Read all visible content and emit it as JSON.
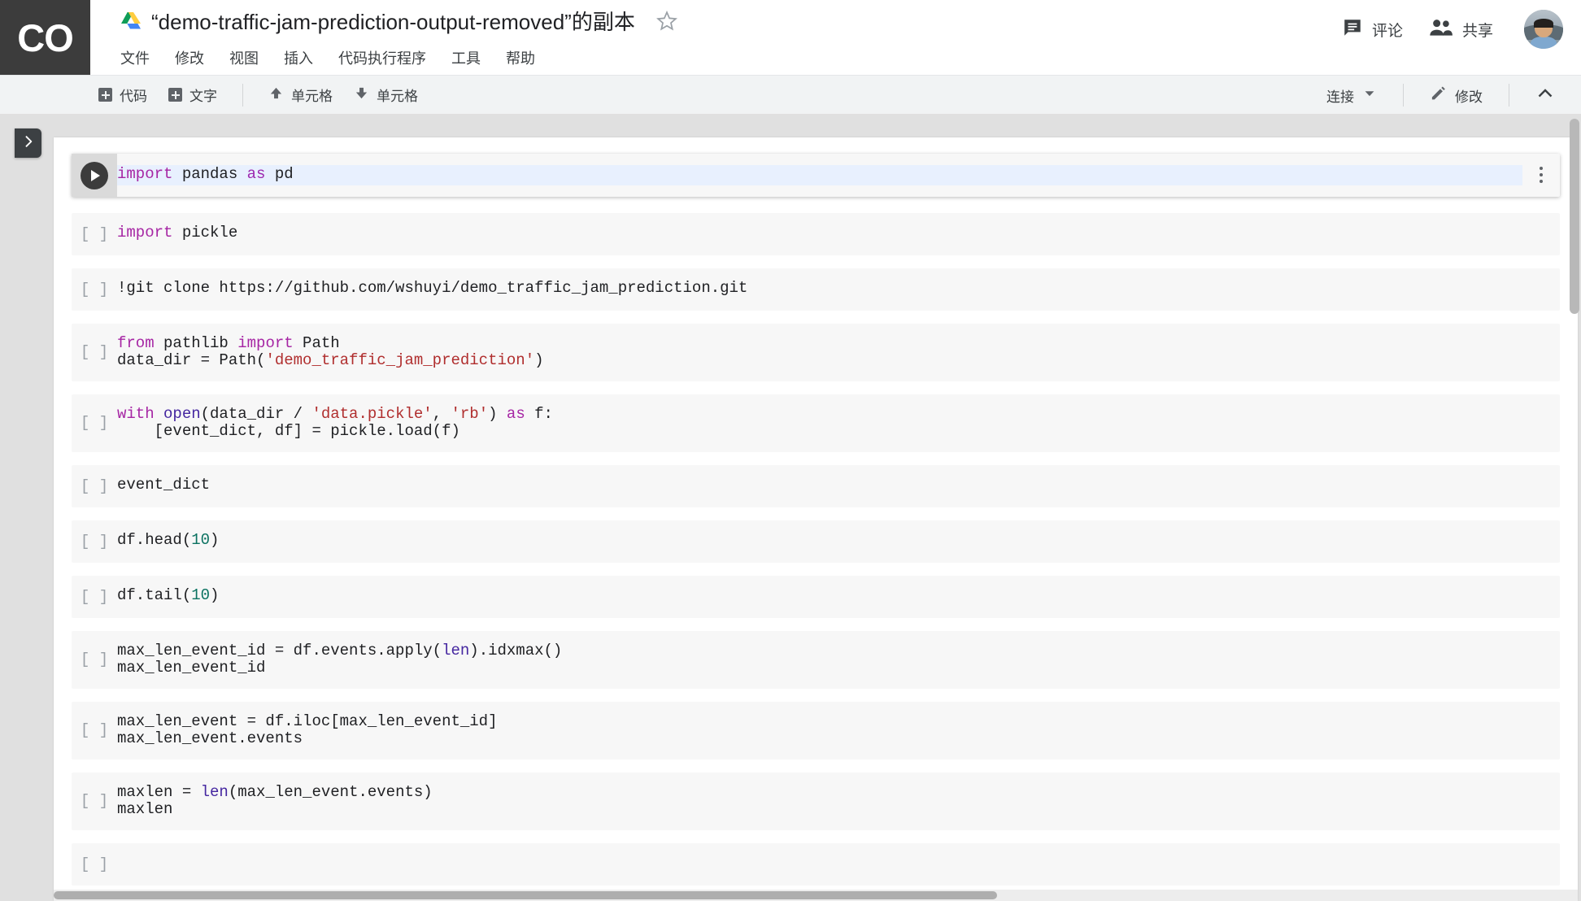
{
  "app": {
    "logo_text": "CO",
    "doc_title": "“demo-traffic-jam-prediction-output-removed”的副本",
    "drive_icon": "google-drive-icon",
    "star_icon": "star-outline-icon"
  },
  "menu": {
    "items": [
      {
        "label": "文件"
      },
      {
        "label": "修改"
      },
      {
        "label": "视图"
      },
      {
        "label": "插入"
      },
      {
        "label": "代码执行程序"
      },
      {
        "label": "工具"
      },
      {
        "label": "帮助"
      }
    ]
  },
  "header_actions": {
    "comment": {
      "label": "评论",
      "icon": "comment-icon"
    },
    "share": {
      "label": "共享",
      "icon": "people-icon"
    },
    "avatar": {
      "icon": "user-avatar"
    }
  },
  "toolbar": {
    "add_code": {
      "label": "代码",
      "icon": "plus-box-icon"
    },
    "add_text": {
      "label": "文字",
      "icon": "plus-box-icon"
    },
    "move_up": {
      "label": "单元格",
      "icon": "arrow-up-icon"
    },
    "move_down": {
      "label": "单元格",
      "icon": "arrow-down-icon"
    },
    "connect": {
      "label": "连接",
      "icon": "chevron-down-icon"
    },
    "edit": {
      "label": "修改",
      "icon": "pencil-icon"
    },
    "collapse": {
      "icon": "chevron-up-icon"
    }
  },
  "sidebar": {
    "toggle_icon": "chevron-right-icon"
  },
  "colors": {
    "keyword": "#a626a4",
    "builtin": "#4527a0",
    "string": "#b02e2e",
    "number": "#0b7261",
    "cell_bg": "#f7f7f7",
    "active_line_bg": "#e8f0fe",
    "logo_bg": "#3c3c3c"
  },
  "notebook": {
    "cells": [
      {
        "prompt": "",
        "active": true,
        "lines": [
          [
            {
              "t": "import",
              "c": "kw"
            },
            {
              "t": " pandas ",
              "c": ""
            },
            {
              "t": "as",
              "c": "kw2"
            },
            {
              "t": " pd",
              "c": ""
            }
          ]
        ]
      },
      {
        "prompt": "[ ]",
        "active": false,
        "lines": [
          [
            {
              "t": "import",
              "c": "kw"
            },
            {
              "t": " pickle",
              "c": ""
            }
          ]
        ]
      },
      {
        "prompt": "[ ]",
        "active": false,
        "lines": [
          [
            {
              "t": "!git clone https://github.com/wshuyi/demo_traffic_jam_prediction.git",
              "c": ""
            }
          ]
        ]
      },
      {
        "prompt": "[ ]",
        "active": false,
        "lines": [
          [
            {
              "t": "from",
              "c": "kw"
            },
            {
              "t": " pathlib ",
              "c": ""
            },
            {
              "t": "import",
              "c": "kw"
            },
            {
              "t": " Path",
              "c": ""
            }
          ],
          [
            {
              "t": "data_dir = Path(",
              "c": ""
            },
            {
              "t": "'demo_traffic_jam_prediction'",
              "c": "str"
            },
            {
              "t": ")",
              "c": ""
            }
          ]
        ]
      },
      {
        "prompt": "[ ]",
        "active": false,
        "lines": [
          [
            {
              "t": "with",
              "c": "kw"
            },
            {
              "t": " ",
              "c": ""
            },
            {
              "t": "open",
              "c": "bi"
            },
            {
              "t": "(data_dir / ",
              "c": ""
            },
            {
              "t": "'data.pickle'",
              "c": "str"
            },
            {
              "t": ", ",
              "c": ""
            },
            {
              "t": "'rb'",
              "c": "str"
            },
            {
              "t": ") ",
              "c": ""
            },
            {
              "t": "as",
              "c": "kw"
            },
            {
              "t": " f:",
              "c": ""
            }
          ],
          [
            {
              "t": "    [event_dict, df] = pickle.load(f)",
              "c": ""
            }
          ]
        ]
      },
      {
        "prompt": "[ ]",
        "active": false,
        "lines": [
          [
            {
              "t": "event_dict",
              "c": ""
            }
          ]
        ]
      },
      {
        "prompt": "[ ]",
        "active": false,
        "lines": [
          [
            {
              "t": "df.head(",
              "c": ""
            },
            {
              "t": "10",
              "c": "num"
            },
            {
              "t": ")",
              "c": ""
            }
          ]
        ]
      },
      {
        "prompt": "[ ]",
        "active": false,
        "lines": [
          [
            {
              "t": "df.tail(",
              "c": ""
            },
            {
              "t": "10",
              "c": "num"
            },
            {
              "t": ")",
              "c": ""
            }
          ]
        ]
      },
      {
        "prompt": "[ ]",
        "active": false,
        "lines": [
          [
            {
              "t": "max_len_event_id = df.events.apply(",
              "c": ""
            },
            {
              "t": "len",
              "c": "bi"
            },
            {
              "t": ").idxmax()",
              "c": ""
            }
          ],
          [
            {
              "t": "max_len_event_id",
              "c": ""
            }
          ]
        ]
      },
      {
        "prompt": "[ ]",
        "active": false,
        "lines": [
          [
            {
              "t": "max_len_event = df.iloc[max_len_event_id]",
              "c": ""
            }
          ],
          [
            {
              "t": "max_len_event.events",
              "c": ""
            }
          ]
        ]
      },
      {
        "prompt": "[ ]",
        "active": false,
        "lines": [
          [
            {
              "t": "maxlen = ",
              "c": ""
            },
            {
              "t": "len",
              "c": "bi"
            },
            {
              "t": "(max_len_event.events)",
              "c": ""
            }
          ],
          [
            {
              "t": "maxlen",
              "c": ""
            }
          ]
        ]
      },
      {
        "prompt": "[ ]",
        "active": false,
        "lines": [
          [
            {
              "t": "",
              "c": ""
            }
          ]
        ]
      }
    ]
  }
}
